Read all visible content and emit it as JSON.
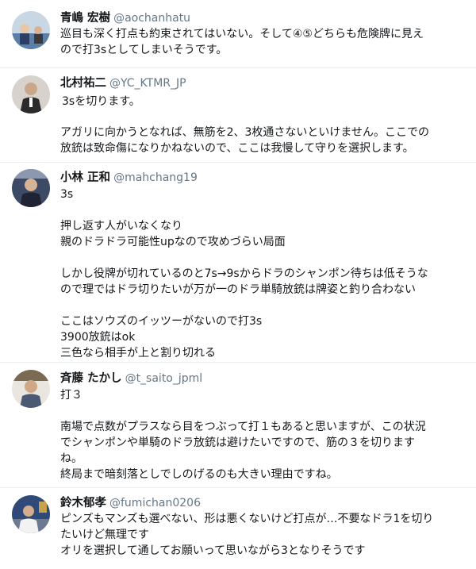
{
  "tweets": [
    {
      "name": "青嶋 宏樹",
      "handle": "@aochanhatu",
      "lines": [
        "巡目も深く打点も約束されてはいない。そして④⑤どちらも危険牌に見え",
        "ので打3sとしてしまいそうです。"
      ]
    },
    {
      "name": "北村祐二",
      "handle": "@YC_KTMR_JP",
      "lines": [
        "3sを切ります。",
        "",
        "アガリに向かうとなれば、無筋を2、3枚通さないといけません。ここでの",
        "放銃は致命傷になりかねないので、ここは我慢して守りを選択します。"
      ]
    },
    {
      "name": "小林 正和",
      "handle": "@mahchang19",
      "lines": [
        "3s",
        "",
        "押し返す人がいなくなり",
        "親のドラドラ可能性upなので攻めづらい局面",
        "",
        "しかし役牌が切れているのと7s→9sからドラのシャンポン待ちは低そうな",
        "ので理ではドラ切りたいが万が一のドラ単騎放銃は牌姿と釣り合わない",
        "",
        "ここはソウズのイッツーがないので打3s",
        "3900放銃はok",
        "三色なら相手が上と割り切れる"
      ]
    },
    {
      "name": "斉藤 たかし",
      "handle": "@t_saito_jpml",
      "lines": [
        "打３",
        "",
        "南場で点数がプラスなら目をつぶって打１もあると思いますが、この状況",
        "でシャンポンや単騎のドラ放銃は避けたいですので、筋の３を切ります",
        "ね。",
        "終局まで暗刻落としでしのげるのも大きい理由ですね。"
      ]
    },
    {
      "name": "鈴木郁孝",
      "handle": "@fumichan0206",
      "lines": [
        "ピンズもマンズも選べない、形は悪くないけど打点が…不要なドラ1を切り",
        "たいけど無理です",
        "オリを選択して通してお願いって思いながら3となりそうです"
      ]
    }
  ],
  "colors": {
    "name": "#14171a",
    "handle": "#657786",
    "divider": "#e6ecf0"
  }
}
